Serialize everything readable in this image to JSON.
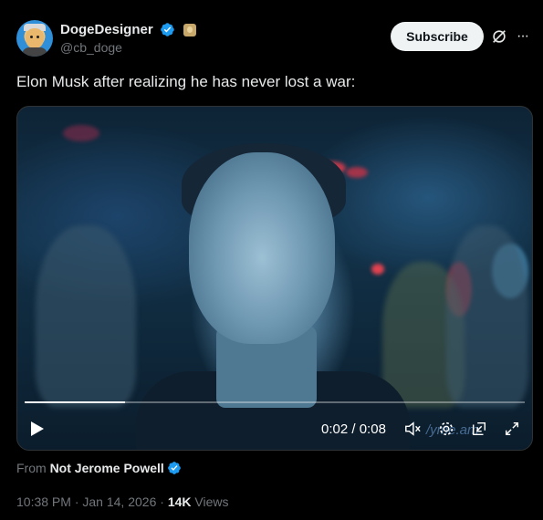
{
  "author": {
    "display_name": "DogeDesigner",
    "handle": "@cb_doge",
    "avatar_icon": "doge-avatar"
  },
  "actions": {
    "subscribe_label": "Subscribe",
    "grok_icon": "grok-icon",
    "more_icon": "more-icon"
  },
  "tweet": {
    "text": "Elon Musk after realizing he has never lost a war:"
  },
  "video": {
    "current_time": "0:02",
    "separator": " / ",
    "duration": "0:08",
    "progress": 0.2,
    "watermark": "/yme.am"
  },
  "source": {
    "from_label": "From",
    "from_name": "Not Jerome Powell"
  },
  "meta": {
    "time": "10:38 PM",
    "dot": " · ",
    "date": "Jan 14, 2026",
    "dot2": " · ",
    "views_count": "14K",
    "views_label": "Views"
  },
  "colors": {
    "verified": "#1d9bf0",
    "background": "#000000",
    "muted_text": "#71767b"
  }
}
